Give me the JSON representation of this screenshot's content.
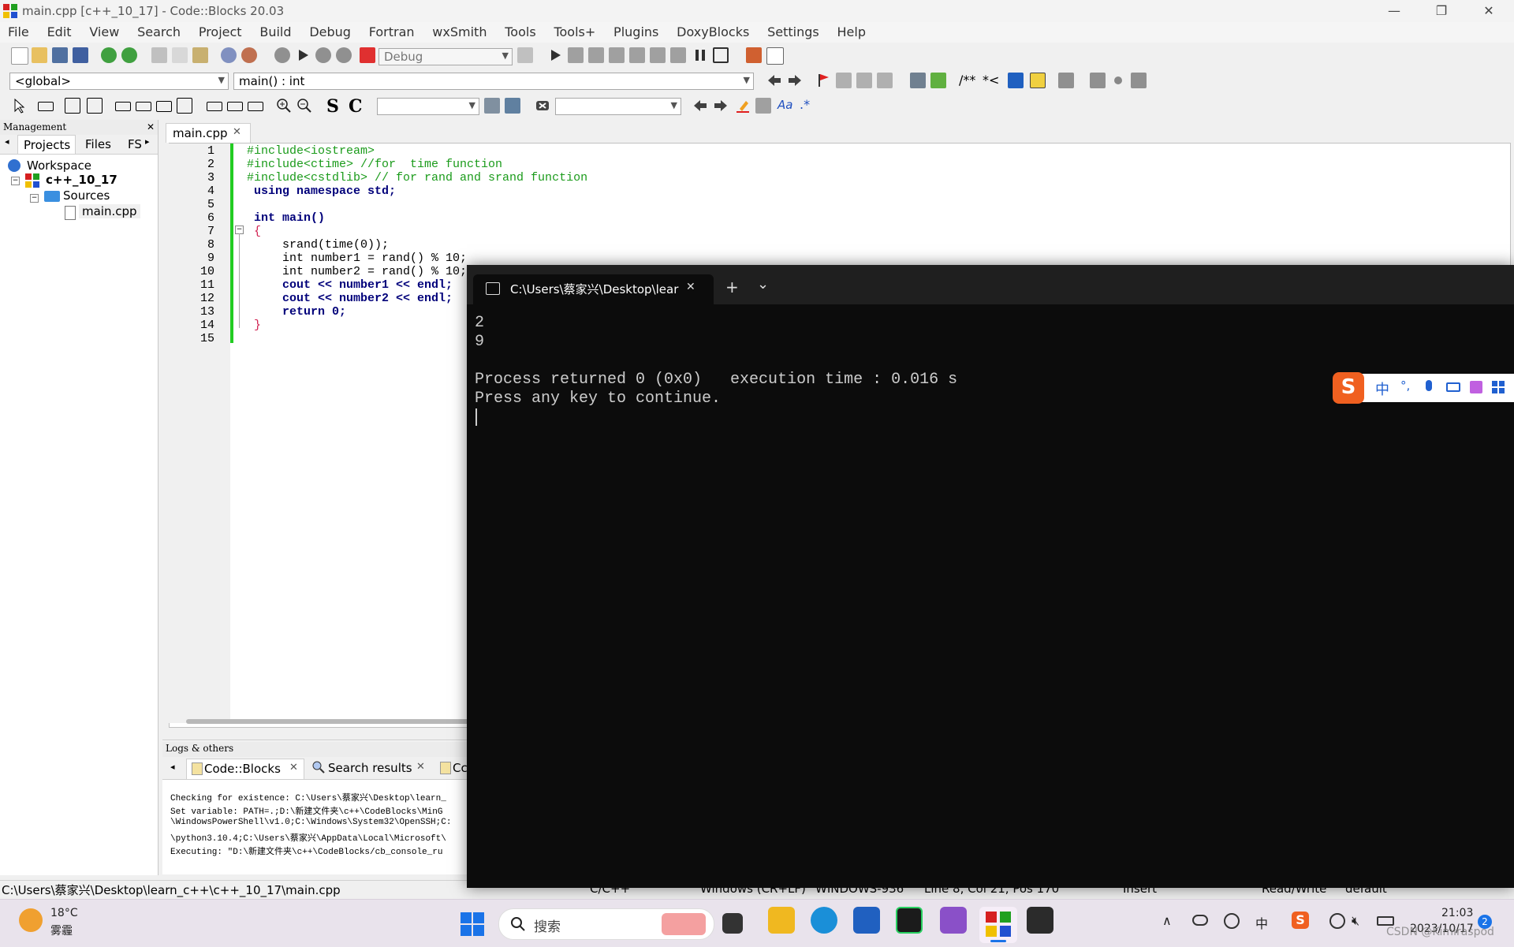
{
  "window": {
    "title": "main.cpp [c++_10_17] - Code::Blocks 20.03",
    "minimize": "—",
    "maximize": "❐",
    "close": "✕"
  },
  "menu": [
    "File",
    "Edit",
    "View",
    "Search",
    "Project",
    "Build",
    "Debug",
    "Fortran",
    "wxSmith",
    "Tools",
    "Tools+",
    "Plugins",
    "DoxyBlocks",
    "Settings",
    "Help"
  ],
  "toolbar": {
    "build_target": "Debug",
    "scope": "<global>",
    "symbol": "main() : int",
    "doc_comment": "/**",
    "doc_inline": "*<",
    "regex_label": "Aa",
    "regex_star": ".*"
  },
  "management": {
    "header": "Management",
    "close": "✕",
    "tabs": [
      "Projects",
      "Files",
      "FS"
    ],
    "tree": {
      "workspace": "Workspace",
      "project": "c++_10_17",
      "folder": "Sources",
      "file": "main.cpp"
    }
  },
  "editor": {
    "tab_label": "main.cpp",
    "tab_close": "✕",
    "line_numbers": [
      "1",
      "2",
      "3",
      "4",
      "5",
      "6",
      "7",
      "8",
      "9",
      "10",
      "11",
      "12",
      "13",
      "14",
      "15"
    ],
    "lines": [
      "#include<iostream>",
      "#include<ctime> //for  time function",
      "#include<cstdlib> // for rand and srand function",
      " using namespace std;",
      "",
      " int main()",
      " {",
      "     srand(time(0));",
      "     int number1 = rand() % 10;",
      "     int number2 = rand() % 10;",
      "     cout << number1 << endl;",
      "     cout << number2 << endl;",
      "     return 0;",
      " }",
      ""
    ]
  },
  "logs": {
    "header": "Logs & others",
    "tabs": [
      "Code::Blocks",
      "Search results",
      "Cc"
    ],
    "lines": [
      "Checking for existence: C:\\Users\\蔡家兴\\Desktop\\learn_",
      "Set variable: PATH=.;D:\\新建文件夹\\c++\\CodeBlocks\\MinG",
      "\\WindowsPowerShell\\v1.0;C:\\Windows\\System32\\OpenSSH;C:",
      "\\python3.10.4;C:\\Users\\蔡家兴\\AppData\\Local\\Microsoft\\",
      "Executing: \"D:\\新建文件夹\\c++\\CodeBlocks/cb_console_ru"
    ]
  },
  "statusbar": {
    "path": "C:\\Users\\蔡家兴\\Desktop\\learn_c++\\c++_10_17\\main.cpp",
    "lang": "C/C++",
    "eol": "Windows (CR+LF)",
    "encoding": "WINDOWS-936",
    "position": "Line 8, Col 21, Pos 170",
    "mode": "Insert",
    "access": "Read/Write",
    "theme": "default"
  },
  "terminal": {
    "tab_title": "C:\\Users\\蔡家兴\\Desktop\\lear",
    "tab_close": "✕",
    "new_tab": "+",
    "dropdown": "⌄",
    "output": [
      "2",
      "9",
      "",
      "Process returned 0 (0x0)   execution time : 0.016 s",
      "Press any key to continue."
    ]
  },
  "ime": {
    "mode": "中",
    "punct": "°,"
  },
  "taskbar": {
    "weather_temp": "18°C",
    "weather_desc": "雾霾",
    "search_placeholder": "搜索",
    "time": "21:03",
    "date": "2023/10/17",
    "notification_count": "2",
    "ime_lang": "中",
    "watermark": "CSDN @Kimiraspod"
  },
  "colors": {
    "terminal_bg": "#0c0c0c",
    "editor_change_bar": "#22cc22",
    "keyword": "#00007a",
    "preprocessor": "#1a9b1a",
    "comment": "#8a8ad6",
    "number": "#e0205a"
  }
}
